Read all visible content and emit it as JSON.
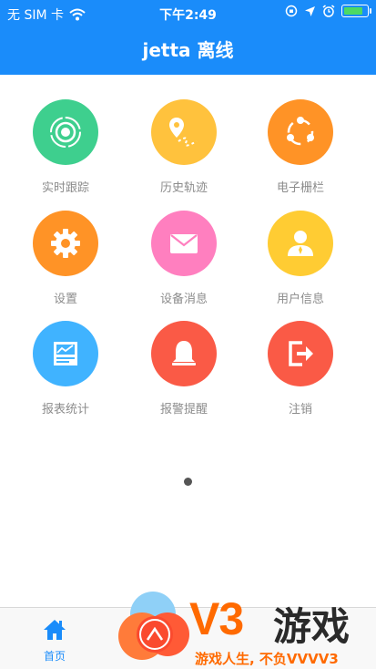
{
  "status_bar": {
    "carrier": "无 SIM 卡",
    "time": "下午2:49",
    "battery_level": 0.84
  },
  "header": {
    "title": "jetta 离线"
  },
  "menu": [
    {
      "label": "实时跟踪",
      "icon": "radar-icon",
      "color": "#3ecf8e"
    },
    {
      "label": "历史轨迹",
      "icon": "route-pin-icon",
      "color": "#ffc23d"
    },
    {
      "label": "电子栅栏",
      "icon": "share-nodes-icon",
      "color": "#ff9326"
    },
    {
      "label": "设置",
      "icon": "gear-icon",
      "color": "#ff9326"
    },
    {
      "label": "设备消息",
      "icon": "envelope-icon",
      "color": "#ff7fbf"
    },
    {
      "label": "用户信息",
      "icon": "user-icon",
      "color": "#ffcc33"
    },
    {
      "label": "报表统计",
      "icon": "report-chart-icon",
      "color": "#40b3ff"
    },
    {
      "label": "报警提醒",
      "icon": "bell-icon",
      "color": "#fa5a46"
    },
    {
      "label": "注销",
      "icon": "logout-icon",
      "color": "#fa5a46"
    }
  ],
  "tab_bar": {
    "home_label": "首页",
    "active_color": "#1a8cfa"
  },
  "watermark": {
    "brand": "V3",
    "name": "游戏",
    "slogan": "游戏人生, 不负VVVV3"
  }
}
